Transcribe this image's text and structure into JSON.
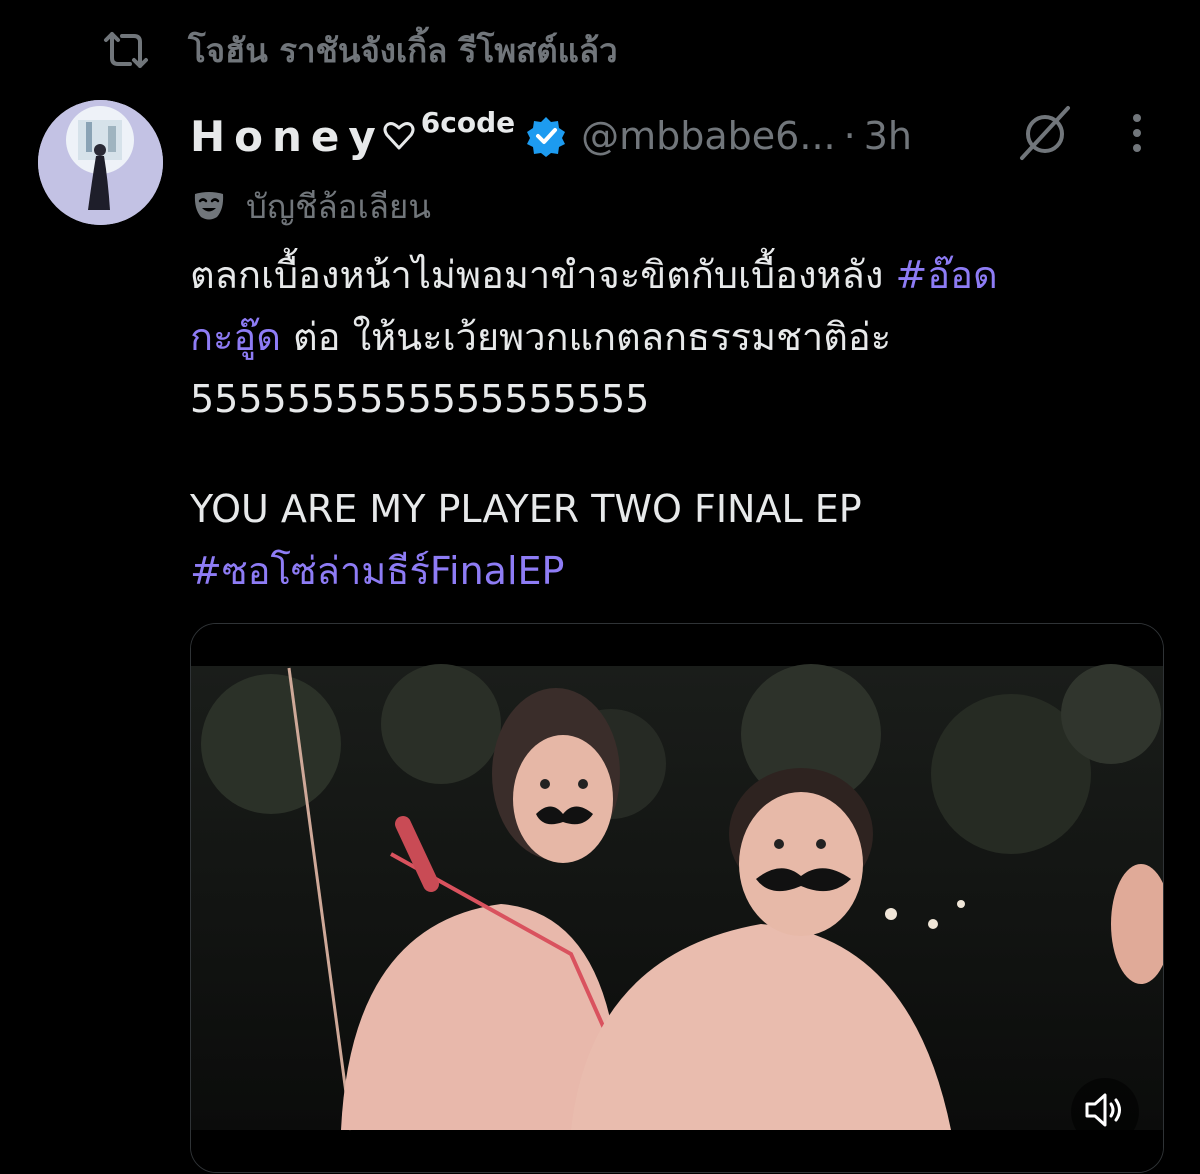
{
  "repost": {
    "icon": "repost-icon",
    "text": "โจฮัน ราชันจังเกิ้ล รีโพสต์แล้ว"
  },
  "tweet": {
    "author": {
      "avatar": "avatar",
      "display_name": "Honey",
      "name_heart_icon": "heart-outline-icon",
      "name_sup": "6code",
      "verified_icon": "verified-badge-icon",
      "handle": "@mbbabe6...",
      "separator": "·",
      "time": "3h"
    },
    "grok_icon": "grok-icon",
    "more_icon": "more-vertical-icon",
    "parody": {
      "icon": "parody-mask-icon",
      "label": "บัญชีล้อเลียน"
    },
    "body": {
      "line1_text": "ตลกเบื้องหน้าไม่พอมาขำจะขิตกับเบื้องหลัง ",
      "hashtag1_part1": "#อ๊อด",
      "hashtag1_part2": "กะอู๊ด",
      "line2_rest": " ต่อ ให้นะเว้ยพวกแกตลกธรรมชาติอ่ะ",
      "line3": "5555555555555555555",
      "line4": "YOU ARE MY PLAYER TWO FINAL EP",
      "hashtag2": "#ซอโซ่ล่ามธีร์FinalEP"
    },
    "media": {
      "type": "video",
      "mute_icon": "volume-icon"
    }
  },
  "colors": {
    "background": "#000000",
    "text": "#e7e9ea",
    "secondary": "#71767b",
    "hashtag": "#8e7cf5",
    "verified": "#1d9bf0"
  }
}
